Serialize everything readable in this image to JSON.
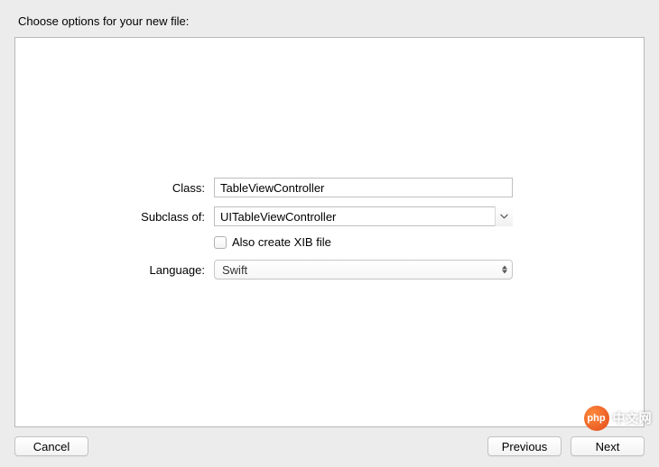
{
  "title": "Choose options for your new file:",
  "form": {
    "class_label": "Class:",
    "class_value": "TableViewController",
    "subclass_label": "Subclass of:",
    "subclass_value": "UITableViewController",
    "xib_label": "Also create XIB file",
    "xib_checked": false,
    "language_label": "Language:",
    "language_value": "Swift"
  },
  "buttons": {
    "cancel": "Cancel",
    "previous": "Previous",
    "next": "Next"
  },
  "watermark": {
    "logo": "php",
    "text": "中文网"
  }
}
